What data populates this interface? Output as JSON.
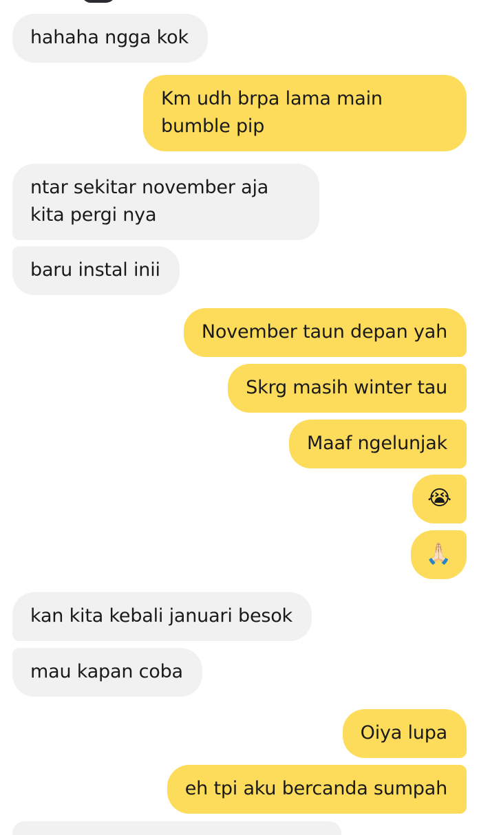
{
  "chat": {
    "messages": [
      {
        "from": "them",
        "text": "hahaha ngga kok"
      },
      {
        "from": "me",
        "text": "Km udh brpa lama main bumble pip"
      },
      {
        "from": "them",
        "text": "ntar sekitar november aja kita pergi nya"
      },
      {
        "from": "them",
        "text": "baru instal inii"
      },
      {
        "from": "me",
        "text": "November taun depan yah"
      },
      {
        "from": "me",
        "text": "Skrg masih winter tau"
      },
      {
        "from": "me",
        "text": "Maaf ngelunjak"
      },
      {
        "from": "me",
        "text": "😭"
      },
      {
        "from": "me",
        "text": "🙏🏻"
      },
      {
        "from": "them",
        "text": "kan kita kebali januari besok"
      },
      {
        "from": "them",
        "text": "mau kapan coba"
      },
      {
        "from": "me",
        "text": "Oiya lupa"
      },
      {
        "from": "me",
        "text": "eh tpi aku bercanda sumpah"
      }
    ]
  },
  "colors": {
    "incoming_bubble": "#f1f1f1",
    "outgoing_bubble": "#fddc5c",
    "text": "#1a1a1a",
    "background": "#ffffff"
  }
}
